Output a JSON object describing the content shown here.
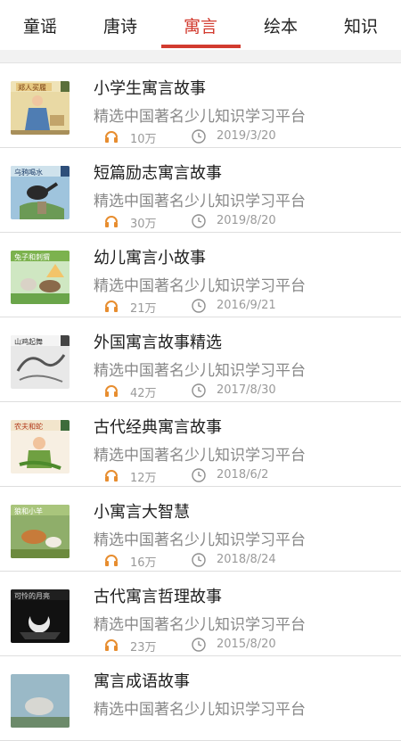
{
  "tabs": [
    {
      "label": "童谣",
      "active": false
    },
    {
      "label": "唐诗",
      "active": false
    },
    {
      "label": "寓言",
      "active": true
    },
    {
      "label": "绘本",
      "active": false
    },
    {
      "label": "知识",
      "active": false
    }
  ],
  "accent_color": "#d23b2f",
  "items": [
    {
      "title": "小学生寓言故事",
      "desc": "精选中国著名少儿知识学习平台",
      "plays": "10万",
      "date": "2019/3/20",
      "cover_text": "郑人买履"
    },
    {
      "title": "短篇励志寓言故事",
      "desc": "精选中国著名少儿知识学习平台",
      "plays": "30万",
      "date": "2019/8/20",
      "cover_text": "乌鸦喝水"
    },
    {
      "title": "幼儿寓言小故事",
      "desc": "精选中国著名少儿知识学习平台",
      "plays": "21万",
      "date": "2016/9/21",
      "cover_text": "兔子和刺猬"
    },
    {
      "title": "外国寓言故事精选",
      "desc": "精选中国著名少儿知识学习平台",
      "plays": "42万",
      "date": "2017/8/30",
      "cover_text": "山鸡起舞"
    },
    {
      "title": "古代经典寓言故事",
      "desc": "精选中国著名少儿知识学习平台",
      "plays": "12万",
      "date": "2018/6/2",
      "cover_text": "农夫和蛇"
    },
    {
      "title": "小寓言大智慧",
      "desc": "精选中国著名少儿知识学习平台",
      "plays": "16万",
      "date": "2018/8/24",
      "cover_text": "狼和小羊"
    },
    {
      "title": "古代寓言哲理故事",
      "desc": "精选中国著名少儿知识学习平台",
      "plays": "23万",
      "date": "2015/8/20",
      "cover_text": "可怜的月亮"
    },
    {
      "title": "寓言成语故事",
      "desc": "精选中国著名少儿知识学习平台",
      "plays": "",
      "date": "",
      "cover_text": ""
    }
  ]
}
